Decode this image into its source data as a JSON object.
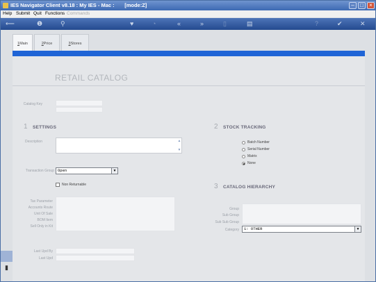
{
  "window": {
    "title": "IES Navigator Client v8.18 : My IES - Mac :       [mode:Z]"
  },
  "menu": {
    "items": [
      "Help",
      "Submit",
      "Quit",
      "Functions",
      "Commands"
    ]
  },
  "tabs": [
    {
      "key": "1",
      "label": "Main"
    },
    {
      "key": "2",
      "label": "Price"
    },
    {
      "key": "3",
      "label": "Stores"
    }
  ],
  "form": {
    "heading": "RETAIL CATALOG",
    "catalog_key_label": "Catalog Key",
    "settings": {
      "number": "1",
      "title": "SETTINGS",
      "description_label": "Description",
      "transaction_group_label": "Transaction Group",
      "transaction_group_value": "Open",
      "non_returnable_label": "Non Returnable",
      "fields": [
        "Tax Parameter",
        "Accounts Route",
        "Unit Of Sale",
        "BOM Item",
        "Sell Only in Kit"
      ],
      "last_upd_by_label": "Last Upd By",
      "last_upd_label": "Last Upd"
    },
    "stock_tracking": {
      "number": "2",
      "title": "STOCK TRACKING",
      "options": [
        "Batch Number",
        "Serial Number",
        "Matrix",
        "None"
      ],
      "selected": "None"
    },
    "catalog_hierarchy": {
      "number": "3",
      "title": "CATALOG HIERARCHY",
      "group_label": "Group",
      "sub_group_label": "Sub Group",
      "sub_sub_group_label": "Sub Sub Group",
      "category_label": "Category",
      "category_value": "1: OTHER"
    }
  },
  "icons": {
    "toolbar": [
      "back-arrow-icon",
      "info-icon",
      "search-icon",
      "heart-icon",
      "clock-icon",
      "rewind-icon",
      "fast-forward-icon",
      "copy-icon",
      "document-icon",
      "help-icon",
      "check-icon",
      "close-icon"
    ]
  },
  "colors": {
    "accent": "#1f64d6",
    "titlebar": "#3d69b3"
  }
}
